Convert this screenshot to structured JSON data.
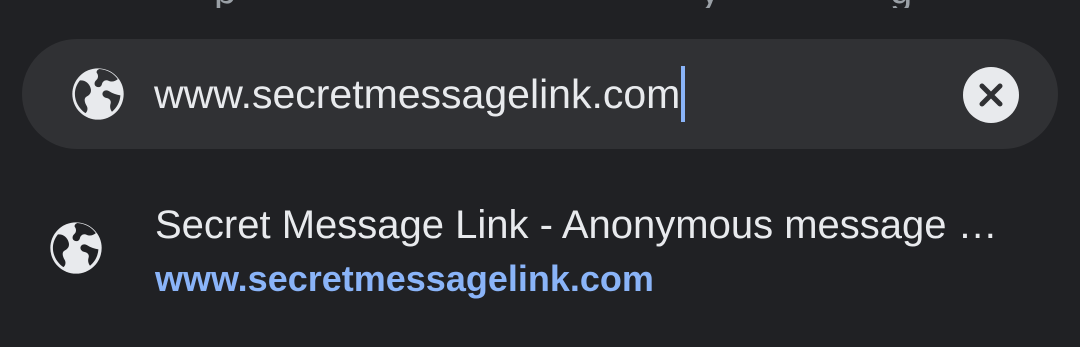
{
  "omnibox": {
    "value": "www.secretmessagelink.com",
    "clear_icon": "close-icon",
    "site_icon": "globe-icon"
  },
  "suggestions": [
    {
      "title": "Secret Message Link - Anonymous message …",
      "url": "www.secretmessagelink.com",
      "icon": "globe-icon"
    }
  ],
  "colors": {
    "background": "#202124",
    "omnibox_background": "#303134",
    "text": "#e8eaed",
    "link": "#8ab4f8",
    "caret": "#8ab4f8"
  }
}
